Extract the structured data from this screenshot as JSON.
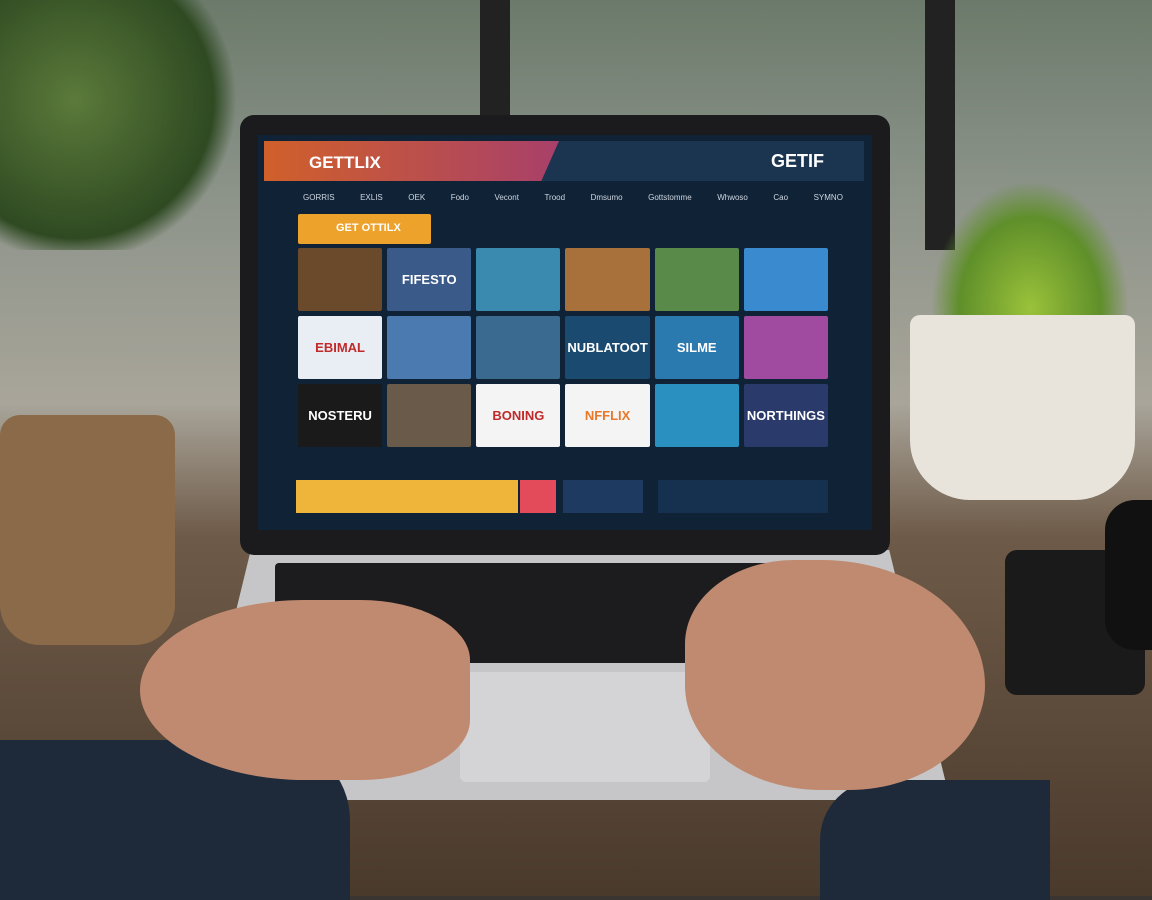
{
  "app": {
    "logo": "GETTLIX",
    "logo_right": "GETIF"
  },
  "nav": [
    "GORRIS",
    "EXLIS",
    "OEK",
    "Fodo",
    "Vecont",
    "Trood",
    "Dmsumo",
    "Gottstomme",
    "Whwoso",
    "Cao",
    "SYMNO"
  ],
  "cta": "GET OTTILX",
  "tiles": [
    {
      "title": "",
      "color": "#6a4a2a"
    },
    {
      "title": "FIFESTO",
      "color": "#3a5a8a"
    },
    {
      "title": "",
      "color": "#3a8ab0"
    },
    {
      "title": "",
      "color": "#a8703a"
    },
    {
      "title": "",
      "color": "#5a8a4a"
    },
    {
      "title": "",
      "color": "#3a8ad0"
    },
    {
      "title": "EBIMAL",
      "color": "#e8eef4"
    },
    {
      "title": "",
      "color": "#4a7ab0"
    },
    {
      "title": "",
      "color": "#3a6a90"
    },
    {
      "title": "NUBLATOOT",
      "color": "#1a4a70"
    },
    {
      "title": "SILME",
      "color": "#2a7ab0"
    },
    {
      "title": "",
      "color": "#a04aa0"
    },
    {
      "title": "NOSTERU",
      "color": "#1a1a1a"
    },
    {
      "title": "",
      "color": "#6a5a4a"
    },
    {
      "title": "BONING",
      "color": "#f4f4f4"
    },
    {
      "title": "NFFLIX",
      "color": "#f4f4f4"
    },
    {
      "title": "",
      "color": "#2a90c0"
    },
    {
      "title": "NORTHINGS",
      "color": "#2a3a6a"
    }
  ],
  "colors": {
    "accent": "#eda22c",
    "screen_bg": "#0f2236"
  }
}
